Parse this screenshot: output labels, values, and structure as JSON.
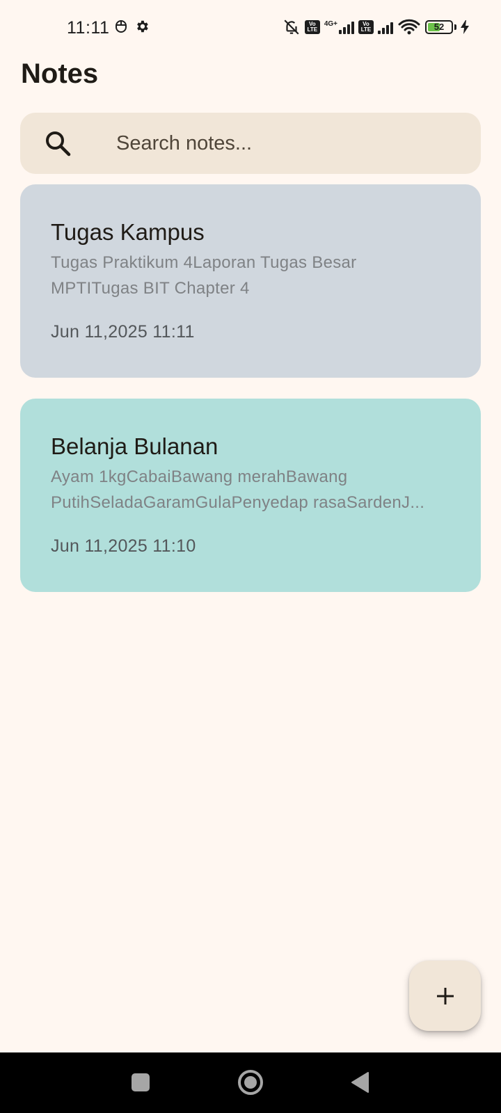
{
  "status_bar": {
    "time": "11:11",
    "network_label": "4G+",
    "volte_label_top": "Vo",
    "volte_label_bottom": "LTE",
    "battery_level": "52",
    "battery_fill_percent": 52
  },
  "header": {
    "title": "Notes"
  },
  "search": {
    "placeholder": "Search notes..."
  },
  "notes": [
    {
      "title": "Tugas Kampus",
      "body": "Tugas Praktikum 4Laporan Tugas Besar MPTITugas BIT Chapter 4",
      "date": "Jun 11,2025 11:11",
      "color": "#d0d7de"
    },
    {
      "title": "Belanja Bulanan",
      "body": "Ayam 1kgCabaiBawang merahBawang PutihSeladaGaramGulaPenyedap rasaSardenJ...",
      "date": "Jun 11,2025 11:10",
      "color": "#b1dfdb"
    }
  ],
  "colors": {
    "background": "#fff7f1",
    "search_background": "#f1e6d8",
    "fab_background": "#f1e6d8"
  },
  "icons": {
    "search": "search-icon",
    "fab": "plus-icon",
    "nav_recents": "square-icon",
    "nav_home": "circle-home-icon",
    "nav_back": "triangle-back-icon"
  }
}
